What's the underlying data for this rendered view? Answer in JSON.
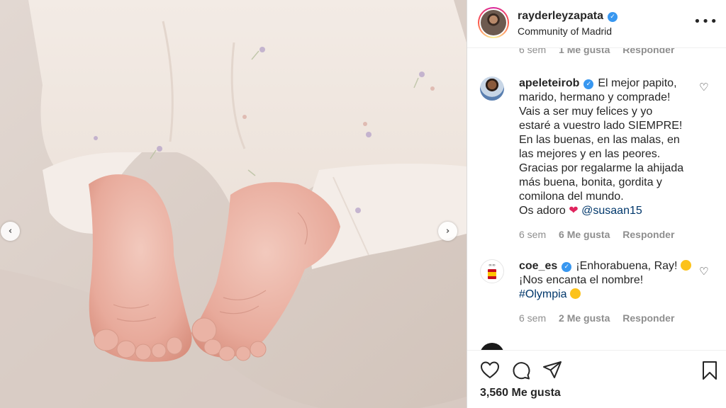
{
  "post": {
    "author": "rayderleyzapata",
    "location": "Community of Madrid",
    "likes": "3,560 Me gusta"
  },
  "colors": {
    "verified": "#3897f0",
    "link": "#00376b",
    "muted": "#8e8e8e"
  },
  "comments": [
    {
      "meta": {
        "time": "6 sem",
        "likes": "1 Me gusta",
        "reply": "Responder"
      }
    },
    {
      "username": "apeleteirob",
      "lines": [
        "El mejor papito,",
        "marido, hermano y comprade!",
        "Vais a ser muy felices y yo",
        "estaré a vuestro lado SIEMPRE!",
        "En las buenas, en las malas, en",
        "las mejores y en las peores.",
        "Gracias por regalarme la ahijada",
        "más buena, bonita, gordita y",
        "comilona del mundo."
      ],
      "last_line_prefix": "Os adoro",
      "mention": "@susaan15",
      "meta": {
        "time": "6 sem",
        "likes": "6 Me gusta",
        "reply": "Responder"
      }
    },
    {
      "username": "coe_es",
      "text1": "¡Enhorabuena, Ray!",
      "text2": "¡Nos encanta el nombre!",
      "hashtag": "#Olympia",
      "meta": {
        "time": "6 sem",
        "likes": "2 Me gusta",
        "reply": "Responder"
      }
    }
  ],
  "icons": {
    "more": "more-options-icon",
    "like": "heart-icon",
    "comment": "comment-icon",
    "share": "share-icon",
    "save": "bookmark-icon"
  }
}
